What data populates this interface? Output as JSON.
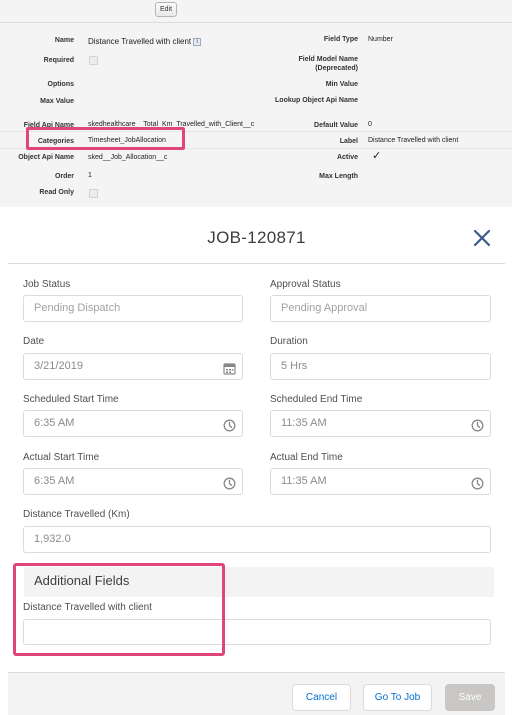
{
  "top_panel": {
    "edit_label": "Edit",
    "rows": {
      "name_label": "Name",
      "name_value": "Distance Travelled with client",
      "field_type_label": "Field Type",
      "field_type_value": "Number",
      "required_label": "Required",
      "field_model_name_label": "Field Model Name (Deprecated)",
      "options_label": "Options",
      "min_value_label": "Min Value",
      "max_value_label": "Max Value",
      "lookup_object_api_label": "Lookup Object Api Name",
      "field_api_name_label": "Field Api Name",
      "field_api_name_value": "skedhealthcare__Total_Km_Travelled_with_Client__c",
      "default_value_label": "Default Value",
      "default_value_value": "0",
      "categories_label": "Categories",
      "categories_value": "Timesheet_JobAllocation",
      "label_label": "Label",
      "label_value": "Distance Travelled with client",
      "object_api_name_label": "Object Api Name",
      "object_api_name_value": "sked__Job_Allocation__c",
      "active_label": "Active",
      "active_value": "✓",
      "order_label": "Order",
      "order_value": "1",
      "max_length_label": "Max Length",
      "read_only_label": "Read Only"
    },
    "info_icon_name": "info-icon",
    "help_icon_name": "help-icon"
  },
  "modal": {
    "title": "JOB-120871",
    "fields": {
      "job_status_label": "Job Status",
      "job_status_value": "Pending Dispatch",
      "approval_status_label": "Approval Status",
      "approval_status_value": "Pending Approval",
      "date_label": "Date",
      "date_value": "3/21/2019",
      "duration_label": "Duration",
      "duration_value": "5 Hrs",
      "scheduled_start_label": "Scheduled Start Time",
      "scheduled_start_value": "6:35 AM",
      "scheduled_end_label": "Scheduled End Time",
      "scheduled_end_value": "11:35 AM",
      "actual_start_label": "Actual Start Time",
      "actual_start_value": "6:35 AM",
      "actual_end_label": "Actual End Time",
      "actual_end_value": "11:35 AM",
      "distance_label": "Distance Travelled (Km)",
      "distance_value": "1,932.0"
    },
    "additional_section_title": "Additional Fields",
    "additional_field_label": "Distance Travelled with client",
    "additional_field_value": "",
    "footer": {
      "cancel_label": "Cancel",
      "goto_label": "Go To Job",
      "save_label": "Save"
    }
  },
  "colors": {
    "highlight": "#e0467c",
    "link_blue": "#0070d2",
    "disabled_button": "#c9c7c5"
  }
}
